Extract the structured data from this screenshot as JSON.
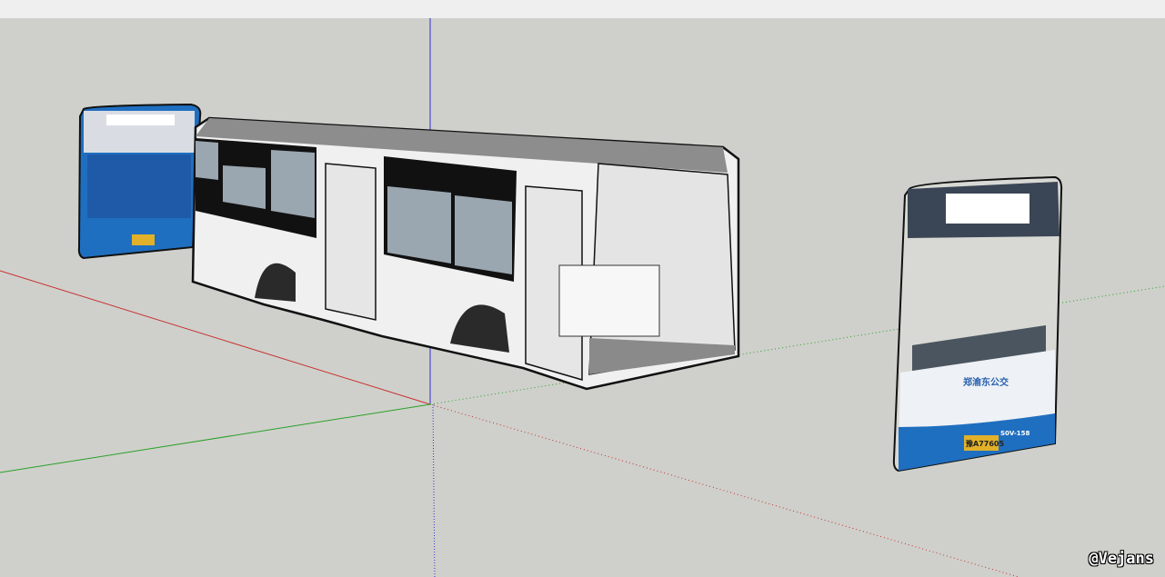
{
  "app": {
    "type": "3d-modeling-viewport"
  },
  "colors": {
    "background": "#cfd0cb",
    "top_bar": "#efefef",
    "axis_red": "#c83030",
    "axis_green": "#2aa02a",
    "axis_blue": "#3030c8",
    "bus_body": "#f2f2f2",
    "bus_blue": "#1f6fc0"
  },
  "model": {
    "objects": [
      "bus-body-shell",
      "bus-rear-face",
      "bus-front-face"
    ],
    "front_texture_text": [
      "郑渝东公交",
      "S0V-158",
      "豫A77605"
    ]
  },
  "watermark": "@Vejans"
}
